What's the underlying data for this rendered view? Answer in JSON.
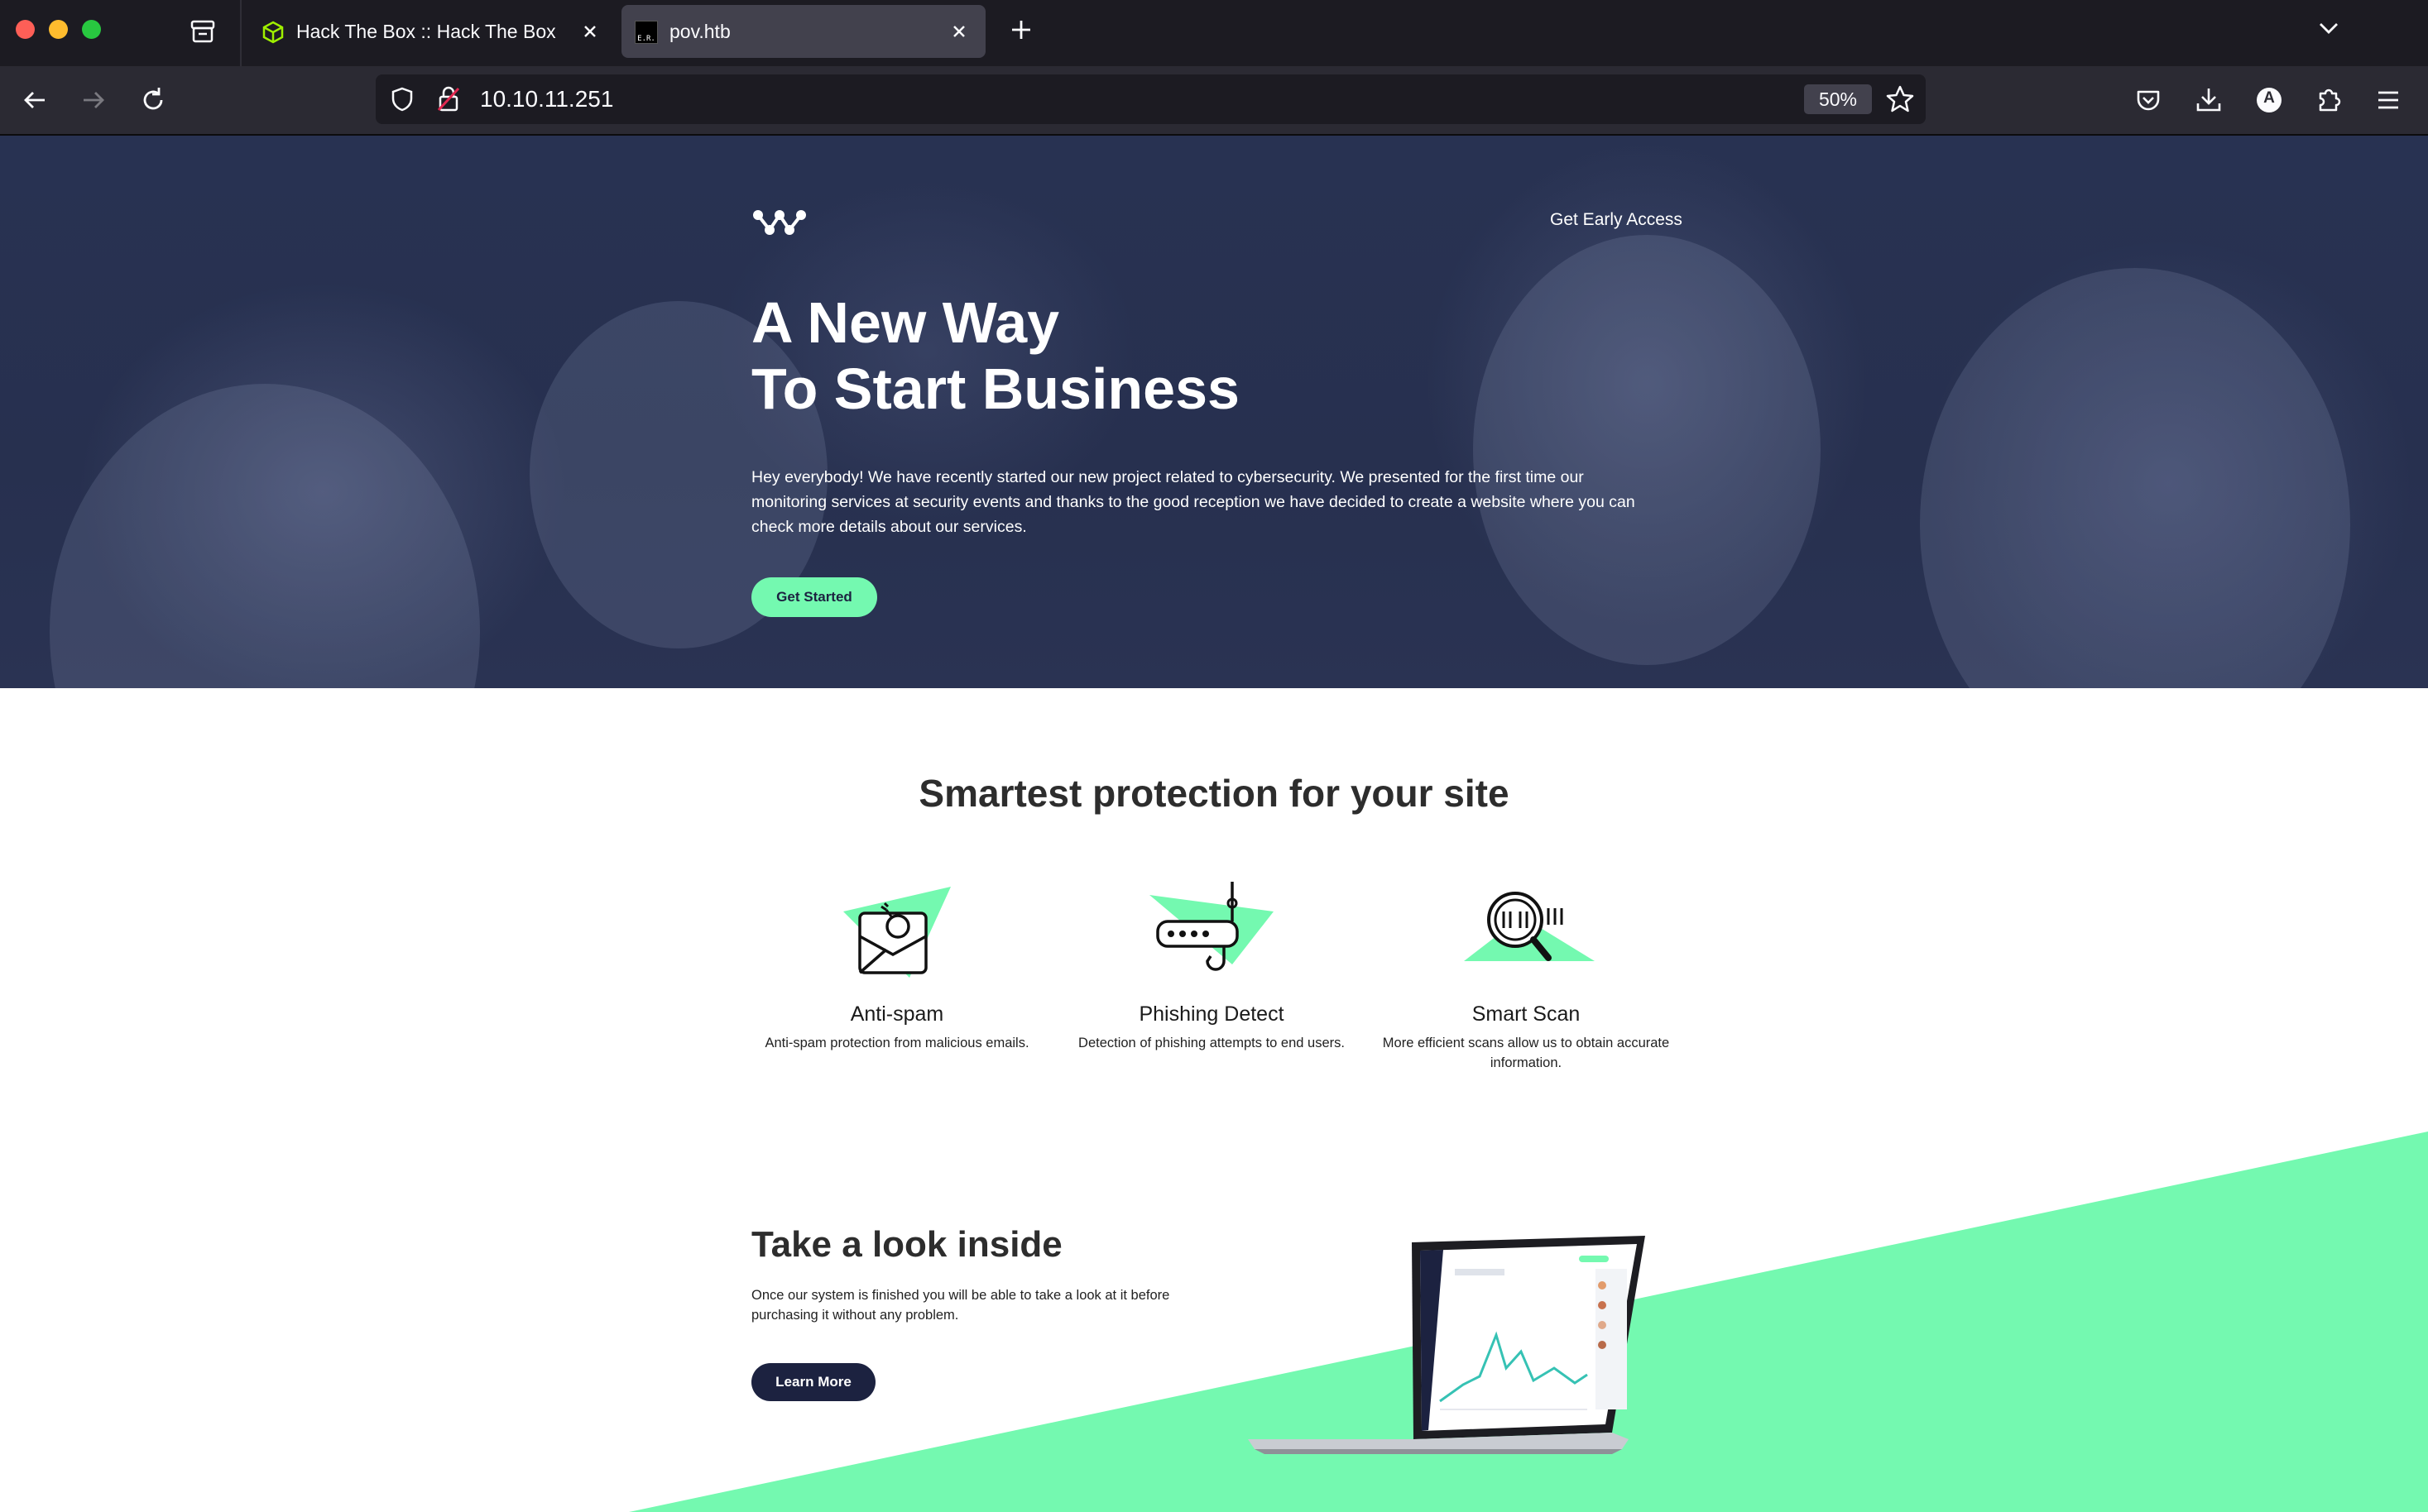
{
  "browser": {
    "tabs": [
      {
        "title": "Hack The Box :: Hack The Box",
        "active": false,
        "favicon": "htb-cube-icon"
      },
      {
        "title": "pov.htb",
        "active": true,
        "favicon": "pov-favicon"
      }
    ],
    "tab2_favicon_text": "E.R.",
    "url": "10.10.11.251",
    "zoom": "50%",
    "account_initial": "A",
    "colors": {
      "chrome_dark": "#1c1b22",
      "toolbar": "#2b2a33",
      "active_tab": "#42414d"
    }
  },
  "page": {
    "hero": {
      "nav_link": "Get Early Access",
      "title_line1": "A New Way",
      "title_line2": "To Start Business",
      "text": "Hey everybody! We have recently started our new project related to cybersecurity. We presented for the first time our monitoring services at security events and thanks to the good reception we have decided to create a website where you can check more details about our services.",
      "cta": "Get Started"
    },
    "features": {
      "title": "Smartest protection for your site",
      "items": [
        {
          "name": "Anti-spam",
          "desc": "Anti-spam protection from malicious emails.",
          "icon": "envelope-bomb-icon"
        },
        {
          "name": "Phishing Detect",
          "desc": "Detection of phishing attempts to end users.",
          "icon": "router-hook-icon"
        },
        {
          "name": "Smart Scan",
          "desc": "More efficient scans allow us to obtain accurate information.",
          "icon": "magnifier-binary-icon"
        }
      ]
    },
    "inside": {
      "title": "Take a look inside",
      "text": "Once our system is finished you will be able to take a look at it before purchasing it without any problem.",
      "cta": "Learn More"
    },
    "colors": {
      "accent": "#74f9b0",
      "navy": "#1c2240",
      "hero_bg": "#283252"
    }
  }
}
